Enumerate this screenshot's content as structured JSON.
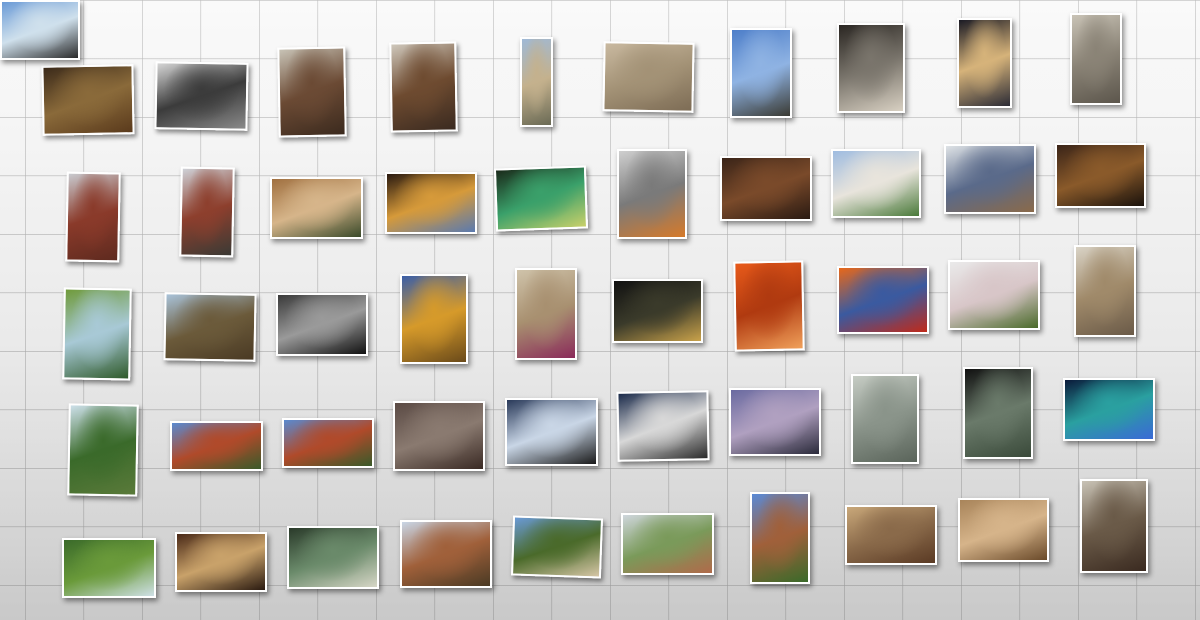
{
  "background": {
    "base": "#ececec",
    "grid_line": "#9a9a9a"
  },
  "photos": [
    {
      "name": "church-dome-interior-photo",
      "colors": [
        "#3b2a1a",
        "#8a6a3a",
        "#5a3a1c"
      ]
    },
    {
      "name": "organ-gallery-interior-photo",
      "colors": [
        "#d6d6d6",
        "#3b3b3b",
        "#8a8a8a"
      ]
    },
    {
      "name": "pipe-organ-photo",
      "colors": [
        "#c8c3b6",
        "#6b4a34",
        "#3b2a1e"
      ]
    },
    {
      "name": "pulpit-carving-photo",
      "colors": [
        "#cfc8bc",
        "#6e4b30",
        "#3a2a20"
      ]
    },
    {
      "name": "church-tower-photo",
      "colors": [
        "#9fb9d6",
        "#c4b18d",
        "#6a6a55"
      ]
    },
    {
      "name": "portal-relief-photo",
      "colors": [
        "#c9b9a0",
        "#a39276",
        "#7d6c55"
      ]
    },
    {
      "name": "church-blue-sky-photo",
      "colors": [
        "#4d7ec9",
        "#8fb3e3",
        "#3a3a33"
      ]
    },
    {
      "name": "narrow-alley-view-photo",
      "colors": [
        "#2a2622",
        "#7a756c",
        "#d8d0c2"
      ]
    },
    {
      "name": "illuminated-nave-photo",
      "colors": [
        "#1a1a24",
        "#d6b37a",
        "#2b2b35"
      ]
    },
    {
      "name": "gothic-vault-interior-photo",
      "colors": [
        "#c9c3b6",
        "#8a8376",
        "#5c564c"
      ]
    },
    {
      "name": "red-brick-church-photo",
      "colors": [
        "#c9cbd0",
        "#8a3a2a",
        "#5e2a1f"
      ]
    },
    {
      "name": "brick-church-statue-photo",
      "colors": [
        "#cfd2d8",
        "#8d3f2d",
        "#3a3a35"
      ]
    },
    {
      "name": "chapel-interior-people-photo",
      "colors": [
        "#a07040",
        "#d6b58a",
        "#3a4a2a"
      ]
    },
    {
      "name": "stained-glass-zoom-photo",
      "colors": [
        "#2a1a10",
        "#d69a3a",
        "#5a7ab0"
      ]
    },
    {
      "name": "stained-glass-burst-photo",
      "colors": [
        "#1a2a1a",
        "#3aa06a",
        "#c9d06a"
      ]
    },
    {
      "name": "church-flowers-photo",
      "colors": [
        "#cfcfcf",
        "#7a7a7a",
        "#d67a2a"
      ]
    },
    {
      "name": "wooden-pews-photo",
      "colors": [
        "#3a2418",
        "#7a4a2a",
        "#2a1a12"
      ]
    },
    {
      "name": "white-villa-photo",
      "colors": [
        "#9fbce0",
        "#e8e4dc",
        "#4a7a3a"
      ]
    },
    {
      "name": "blue-pews-hall-photo",
      "colors": [
        "#dfe3e6",
        "#5a6a8a",
        "#8a6a4a"
      ]
    },
    {
      "name": "dark-church-interior-photo",
      "colors": [
        "#3a2418",
        "#8a5a2a",
        "#1a120c"
      ]
    },
    {
      "name": "castle-by-lake-photo",
      "colors": [
        "#6f9a3a",
        "#a8c9d6",
        "#2f5a2a"
      ]
    },
    {
      "name": "plowed-field-photo",
      "colors": [
        "#a9c3da",
        "#6b5a3a",
        "#4a3a24"
      ]
    },
    {
      "name": "foggy-night-light-photo",
      "colors": [
        "#3a3a3a",
        "#9a9a9a",
        "#111111"
      ]
    },
    {
      "name": "autumn-church-photo",
      "colors": [
        "#3a5ea8",
        "#d69a2a",
        "#6a4a1a"
      ]
    },
    {
      "name": "nave-red-carpet-photo",
      "colors": [
        "#cfc3aa",
        "#a89070",
        "#8a2a5a"
      ]
    },
    {
      "name": "candles-dark-photo",
      "colors": [
        "#111111",
        "#3a3a2a",
        "#c9a24a"
      ]
    },
    {
      "name": "red-orange-abstract-photo",
      "colors": [
        "#e85a1a",
        "#b03a10",
        "#f0a05a"
      ]
    },
    {
      "name": "orange-glass-window-photo",
      "colors": [
        "#e8681a",
        "#3a5aa0",
        "#c02a1a"
      ]
    },
    {
      "name": "blossom-closeup-photo",
      "colors": [
        "#eaeaea",
        "#d8c6c8",
        "#4a6a2a"
      ]
    },
    {
      "name": "ornate-ceiling-photo",
      "colors": [
        "#d9d3c6",
        "#a08a6a",
        "#6a5a48"
      ]
    },
    {
      "name": "tower-through-trees-photo",
      "colors": [
        "#cde0ea",
        "#3a6a2a",
        "#5a7a3a"
      ]
    },
    {
      "name": "village-rooftops-photo",
      "colors": [
        "#5a8ad0",
        "#b04a2a",
        "#3a5a2a"
      ]
    },
    {
      "name": "village-rooftops-copy-photo",
      "colors": [
        "#5a8ad0",
        "#b04a2a",
        "#3a5a2a"
      ]
    },
    {
      "name": "stone-window-photo",
      "colors": [
        "#5a4a44",
        "#8a7a70",
        "#3a2a24"
      ]
    },
    {
      "name": "backlit-church-photo",
      "colors": [
        "#2a3a5a",
        "#c9d6e6",
        "#1a1a1a"
      ]
    },
    {
      "name": "church-dusk-photo",
      "colors": [
        "#1a2a4a",
        "#d8d8d8",
        "#2a2a2a"
      ]
    },
    {
      "name": "spire-twilight-photo",
      "colors": [
        "#6a6aa0",
        "#b0a0c0",
        "#2a2a3a"
      ]
    },
    {
      "name": "misty-towers-photo",
      "colors": [
        "#c6ccc4",
        "#8a948a",
        "#5a645a"
      ]
    },
    {
      "name": "dark-forest-window-photo",
      "colors": [
        "#111111",
        "#6a7a6a",
        "#3a4a3a"
      ]
    },
    {
      "name": "illuminated-cathedral-photo",
      "colors": [
        "#0a1a3a",
        "#2aa0a0",
        "#3a6ad6"
      ]
    },
    {
      "name": "green-trees-tower-photo",
      "colors": [
        "#3a6a2a",
        "#6a9a3a",
        "#cfe0e6"
      ]
    },
    {
      "name": "wooden-hall-interior-photo",
      "colors": [
        "#4a2a18",
        "#c9a26a",
        "#2a1a10"
      ]
    },
    {
      "name": "sign-board-photo",
      "colors": [
        "#2a3a2a",
        "#6a8a6a",
        "#d6d6c6"
      ]
    },
    {
      "name": "autumn-chapel-photo",
      "colors": [
        "#c9d6e6",
        "#a0603a",
        "#4a3a24"
      ]
    },
    {
      "name": "hill-village-photo",
      "colors": [
        "#6a9ad6",
        "#4a6a2a",
        "#d6c6a6"
      ]
    },
    {
      "name": "town-panorama-photo",
      "colors": [
        "#cfd6dc",
        "#7a9a5a",
        "#b06a4a"
      ]
    },
    {
      "name": "church-village-photo",
      "colors": [
        "#5a8ad6",
        "#a0603a",
        "#3a6a2a"
      ]
    },
    {
      "name": "gothic-doorway-photo",
      "colors": [
        "#c9a87a",
        "#8a6a4a",
        "#5a3a24"
      ]
    },
    {
      "name": "arch-sculpture-photo",
      "colors": [
        "#a8845a",
        "#d6b48a",
        "#6a4a2a"
      ]
    },
    {
      "name": "church-aisle-photo",
      "colors": [
        "#c9c3b6",
        "#6a5a48",
        "#3a2a20"
      ]
    },
    {
      "name": "people-with-sign-photo",
      "colors": [
        "#6a9ad6",
        "#cfe0ec",
        "#2a2a2a"
      ]
    }
  ]
}
